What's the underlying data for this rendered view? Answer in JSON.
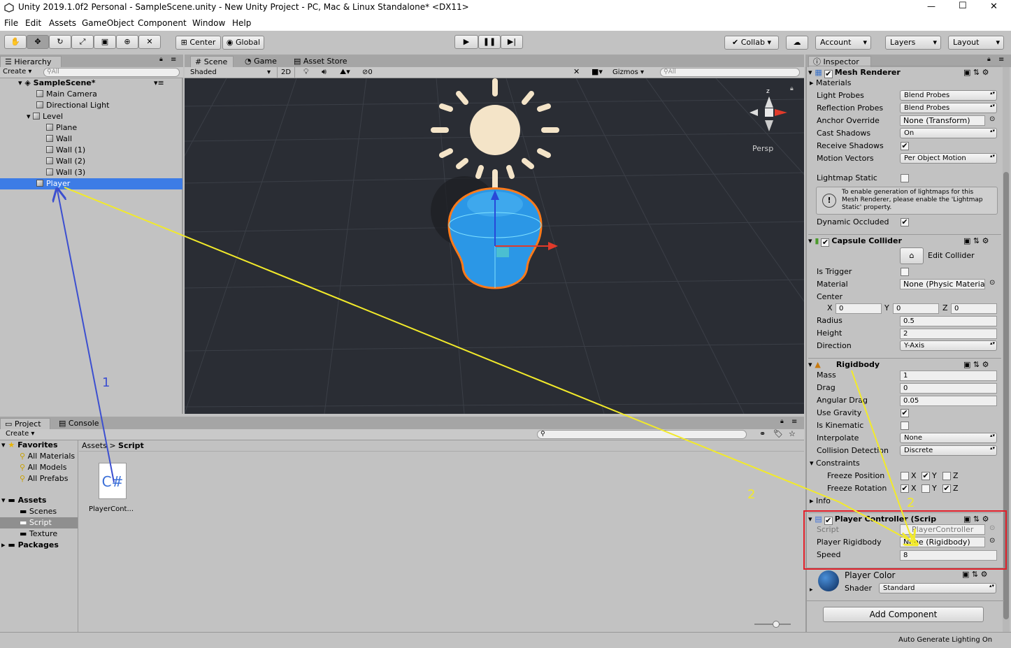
{
  "window": {
    "title": "Unity 2019.1.0f2 Personal - SampleScene.unity - New Unity Project - PC, Mac & Linux Standalone* <DX11>",
    "minimize": "—",
    "maximize": "☐",
    "close": "✕"
  },
  "menu": [
    "File",
    "Edit",
    "Assets",
    "GameObject",
    "Component",
    "Window",
    "Help"
  ],
  "toolbar": {
    "center": "Center",
    "global": "Global",
    "collab": "Collab",
    "account": "Account",
    "layers": "Layers",
    "layout": "Layout"
  },
  "hierarchy": {
    "tab": "Hierarchy",
    "create": "Create",
    "search_placeholder": "All",
    "scene": "SampleScene*",
    "items": [
      "Main Camera",
      "Directional Light",
      "Level",
      "Plane",
      "Wall",
      "Wall (1)",
      "Wall (2)",
      "Wall (3)",
      "Player"
    ]
  },
  "scene_tabs": {
    "scene": "Scene",
    "game": "Game",
    "asset_store": "Asset Store",
    "shaded": "Shaded",
    "mode2d": "2D",
    "gizmos": "Gizmos",
    "search_placeholder": "All",
    "persp": "Persp",
    "fx_count": "0",
    "axis_z": "z"
  },
  "project": {
    "tab": "Project",
    "console": "Console",
    "create": "Create",
    "favorites": "Favorites",
    "fav_items": [
      "All Materials",
      "All Models",
      "All Prefabs"
    ],
    "assets": "Assets",
    "asset_items": [
      "Scenes",
      "Script",
      "Texture"
    ],
    "packages": "Packages",
    "breadcrumb_root": "Assets",
    "breadcrumb_sep": ">",
    "breadcrumb_current": "Script",
    "file_label": "PlayerCont...",
    "file_icon": "C#"
  },
  "inspector": {
    "tab": "Inspector",
    "mesh_renderer": {
      "title": "Mesh Renderer",
      "materials": "Materials",
      "light_probes_label": "Light Probes",
      "light_probes": "Blend Probes",
      "reflection_label": "Reflection Probes",
      "reflection": "Blend Probes",
      "anchor_label": "Anchor Override",
      "anchor": "None (Transform)",
      "cast_label": "Cast Shadows",
      "cast": "On",
      "receive_label": "Receive Shadows",
      "motion_label": "Motion Vectors",
      "motion": "Per Object Motion",
      "lightmap_label": "Lightmap Static",
      "help": "To enable generation of lightmaps for this Mesh Renderer, please enable the 'Lightmap Static' property.",
      "dynamic_label": "Dynamic Occluded",
      "checked": "✔"
    },
    "capsule": {
      "title": "Capsule Collider",
      "edit": "Edit Collider",
      "trigger_label": "Is Trigger",
      "material_label": "Material",
      "material": "None (Physic Materia",
      "center_label": "Center",
      "x_label": "X",
      "x": "0",
      "y_label": "Y",
      "y": "0",
      "z_label": "Z",
      "z": "0",
      "radius_label": "Radius",
      "radius": "0.5",
      "height_label": "Height",
      "height": "2",
      "direction_label": "Direction",
      "direction": "Y-Axis"
    },
    "rigidbody": {
      "title": "Rigidbody",
      "mass_label": "Mass",
      "mass": "1",
      "drag_label": "Drag",
      "drag": "0",
      "angular_label": "Angular Drag",
      "angular": "0.05",
      "gravity_label": "Use Gravity",
      "kinematic_label": "Is Kinematic",
      "interpolate_label": "Interpolate",
      "interpolate": "None",
      "collision_label": "Collision Detection",
      "collision": "Discrete",
      "constraints": "Constraints",
      "freeze_pos": "Freeze Position",
      "freeze_rot": "Freeze Rotation",
      "info": "Info"
    },
    "player_controller": {
      "title": "Player Controller (Scrip",
      "script_label": "Script",
      "script": "PlayerController",
      "rb_label": "Player Rigidbody",
      "rb": "None (Rigidbody)",
      "speed_label": "Speed",
      "speed": "8"
    },
    "material": {
      "title": "Player Color",
      "shader_label": "Shader",
      "shader": "Standard"
    },
    "add_component": "Add Component"
  },
  "status": {
    "lighting": "Auto Generate Lighting On"
  },
  "annotations": {
    "step1": "1",
    "step2a": "2",
    "step2b": "2"
  },
  "colors": {
    "selection": "#3d7ce6",
    "scene_bg": "#2a2d34",
    "highlight_box": "#e0202a",
    "arrow_blue": "#3c4fd0",
    "arrow_yellow": "#f2ea2a"
  }
}
